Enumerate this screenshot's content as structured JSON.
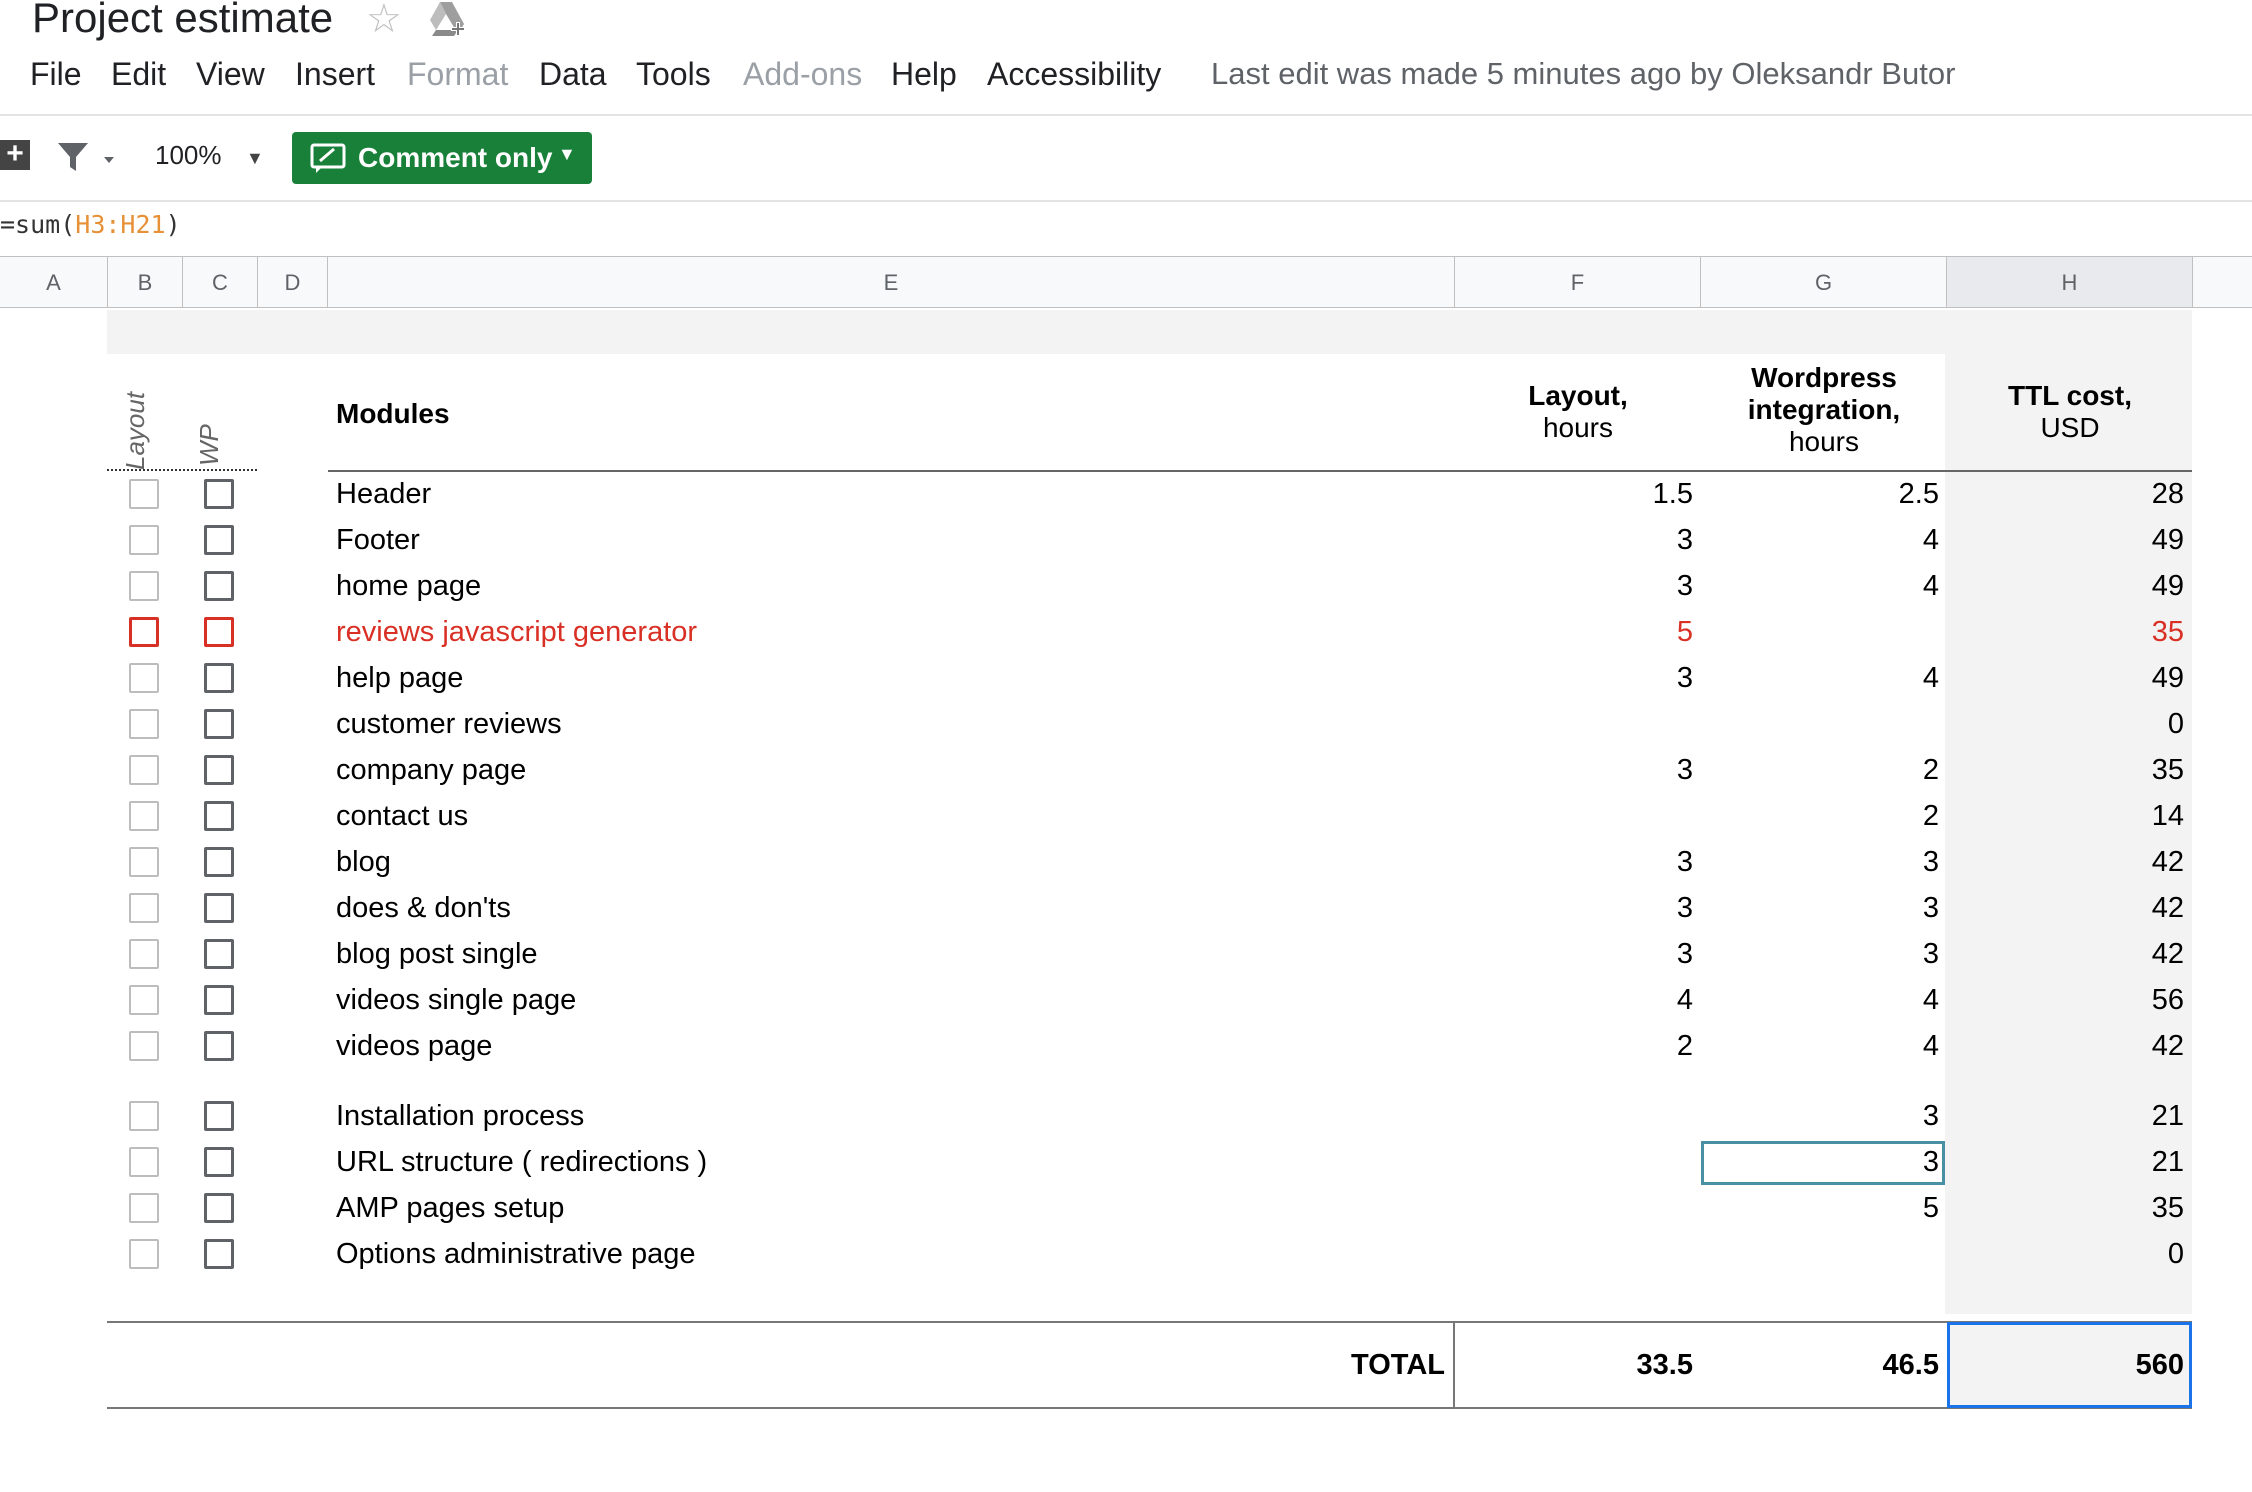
{
  "doc": {
    "title": "Project estimate",
    "star_icon": "star-icon",
    "drive_icon": "add-to-drive-icon"
  },
  "menu": {
    "items": [
      {
        "label": "File",
        "dim": false
      },
      {
        "label": "Edit",
        "dim": false
      },
      {
        "label": "View",
        "dim": false
      },
      {
        "label": "Insert",
        "dim": false
      },
      {
        "label": "Format",
        "dim": true
      },
      {
        "label": "Data",
        "dim": false
      },
      {
        "label": "Tools",
        "dim": false
      },
      {
        "label": "Add-ons",
        "dim": true
      },
      {
        "label": "Help",
        "dim": false
      },
      {
        "label": "Accessibility",
        "dim": false
      }
    ],
    "last_edit": "Last edit was made 5 minutes ago by Oleksandr Butor"
  },
  "toolbar": {
    "zoom": "100%",
    "comment_label": "Comment only",
    "accent": "#188038"
  },
  "formula": {
    "prefix": "=sum(",
    "ref": "H3:H21",
    "suffix": ")"
  },
  "columns": [
    "A",
    "B",
    "C",
    "D",
    "E",
    "F",
    "G",
    "H"
  ],
  "table": {
    "vertical_labels": {
      "layout": "Layout",
      "wp": "WP"
    },
    "headers": {
      "modules": "Modules",
      "layout_l1": "Layout,",
      "layout_l2": "hours",
      "wp_l1": "Wordpress",
      "wp_l2": "integration,",
      "wp_l3": "hours",
      "ttl_l1": "TTL cost,",
      "ttl_l2": "USD"
    },
    "rows": [
      {
        "name": "Header",
        "layout": "1.5",
        "wp": "2.5",
        "ttl": "28",
        "red": false
      },
      {
        "name": "Footer",
        "layout": "3",
        "wp": "4",
        "ttl": "49",
        "red": false
      },
      {
        "name": "home page",
        "layout": "3",
        "wp": "4",
        "ttl": "49",
        "red": false
      },
      {
        "name": "reviews javascript generator",
        "layout": "5",
        "wp": "",
        "ttl": "35",
        "red": true
      },
      {
        "name": "help page",
        "layout": "3",
        "wp": "4",
        "ttl": "49",
        "red": false
      },
      {
        "name": "customer reviews",
        "layout": "",
        "wp": "",
        "ttl": "0",
        "red": false
      },
      {
        "name": "company page",
        "layout": "3",
        "wp": "2",
        "ttl": "35",
        "red": false
      },
      {
        "name": "contact us",
        "layout": "",
        "wp": "2",
        "ttl": "14",
        "red": false
      },
      {
        "name": "blog",
        "layout": "3",
        "wp": "3",
        "ttl": "42",
        "red": false
      },
      {
        "name": "does & don'ts",
        "layout": "3",
        "wp": "3",
        "ttl": "42",
        "red": false
      },
      {
        "name": "blog post single",
        "layout": "3",
        "wp": "3",
        "ttl": "42",
        "red": false
      },
      {
        "name": "videos single page",
        "layout": "4",
        "wp": "4",
        "ttl": "56",
        "red": false
      },
      {
        "name": "videos page",
        "layout": "2",
        "wp": "4",
        "ttl": "42",
        "red": false
      },
      {
        "name": "Installation process",
        "layout": "",
        "wp": "3",
        "ttl": "21",
        "red": false
      },
      {
        "name": "URL structure ( redirections )",
        "layout": "",
        "wp": "3",
        "ttl": "21",
        "red": false
      },
      {
        "name": "AMP pages setup",
        "layout": "",
        "wp": "5",
        "ttl": "35",
        "red": false
      },
      {
        "name": "Options administrative page",
        "layout": "",
        "wp": "",
        "ttl": "0",
        "red": false
      }
    ],
    "total": {
      "label": "TOTAL",
      "layout": "33.5",
      "wp": "46.5",
      "ttl": "560"
    },
    "colors": {
      "red": "#d93025",
      "selection": "#1a73e8"
    }
  }
}
